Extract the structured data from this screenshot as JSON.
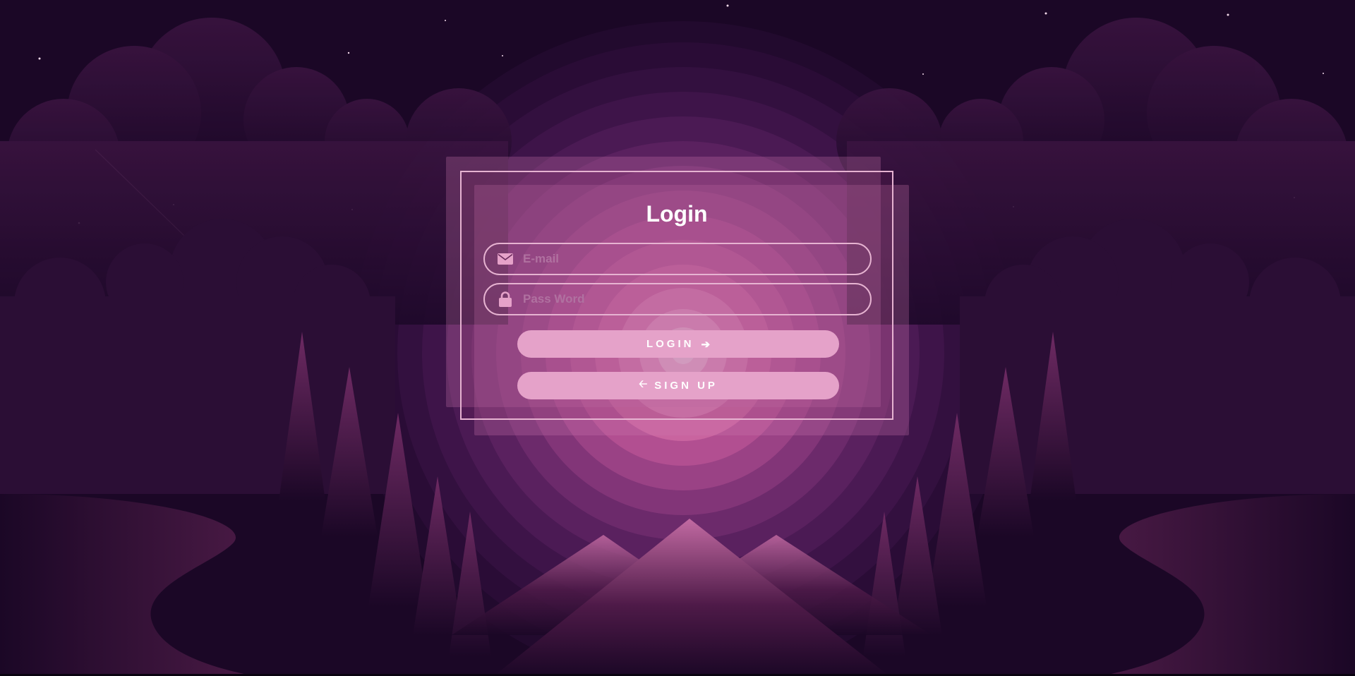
{
  "login_form": {
    "title": "Login",
    "email": {
      "placeholder": "E-mail",
      "value": "",
      "icon": "envelope-icon"
    },
    "password": {
      "placeholder": "Pass Word",
      "value": "",
      "icon": "lock-icon"
    },
    "login_button": {
      "label": "LOGIN",
      "icon": "arrow-right-icon"
    },
    "signup_button": {
      "label": "SIGN UP",
      "icon": "arrow-left-icon"
    }
  },
  "colors": {
    "background": "#1b0726",
    "accent": "#e5a2c9",
    "border": "#e6b3d1",
    "glow": "#f6c8e0"
  }
}
